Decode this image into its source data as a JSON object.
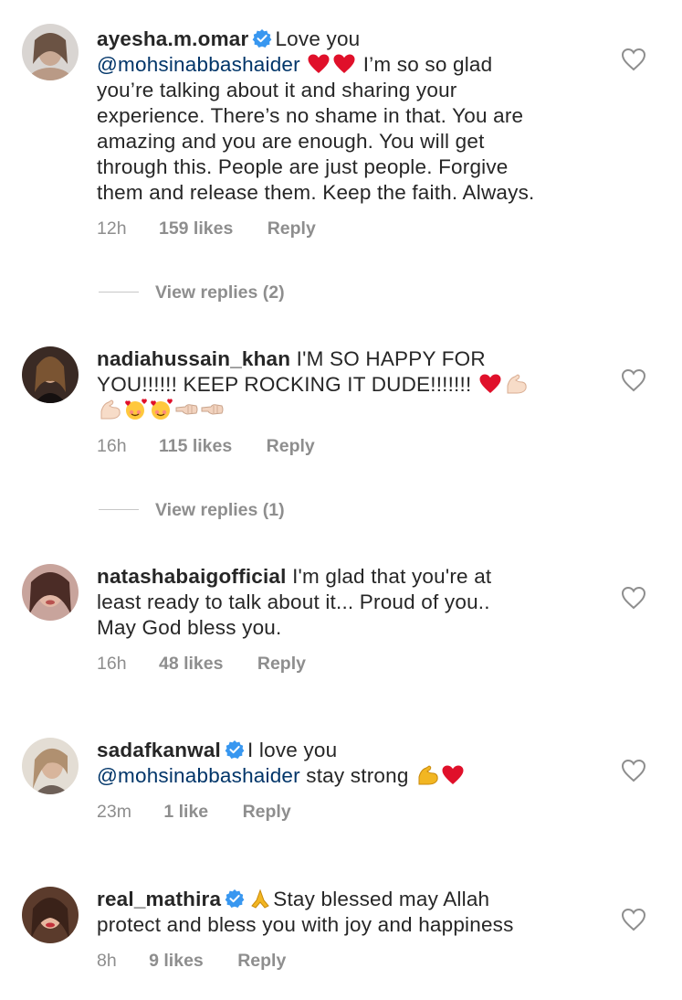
{
  "comments": [
    {
      "username": "ayesha.m.omar",
      "verified": true,
      "lines": [
        {
          "parts": [
            {
              "t": "Love you"
            }
          ]
        },
        {
          "parts": [
            {
              "m": "@mohsinabbashaider"
            },
            {
              "e": "heart"
            },
            {
              "e": "heart"
            },
            {
              "t": " I’m so so glad"
            }
          ]
        },
        {
          "parts": [
            {
              "t": "you’re talking about it and sharing your"
            }
          ]
        },
        {
          "parts": [
            {
              "t": "experience. There’s no shame in that. You are"
            }
          ]
        },
        {
          "parts": [
            {
              "t": "amazing and you are enough. You will get"
            }
          ]
        },
        {
          "parts": [
            {
              "t": "through this. People are just people. Forgive"
            }
          ]
        },
        {
          "parts": [
            {
              "t": "them and release them. Keep the faith. Always."
            }
          ]
        }
      ],
      "time": "12h",
      "likes": "159 likes",
      "reply": "Reply",
      "view_replies": "View replies (2)"
    },
    {
      "username": "nadiahussain_khan",
      "verified": false,
      "lines": [
        {
          "parts": [
            {
              "t": "I'M SO HAPPY FOR"
            }
          ]
        },
        {
          "parts": [
            {
              "t": "YOU!!!!!! KEEP ROCKING IT DUDE!!!!!!! "
            },
            {
              "e": "heart"
            },
            {
              "e": "muscle-light"
            }
          ]
        },
        {
          "parts": [
            {
              "e": "muscle-light"
            },
            {
              "e": "smiling-hearts"
            },
            {
              "e": "smiling-hearts"
            },
            {
              "e": "fist-left"
            },
            {
              "e": "fist-left"
            }
          ]
        }
      ],
      "time": "16h",
      "likes": "115 likes",
      "reply": "Reply",
      "view_replies": "View replies (1)"
    },
    {
      "username": "natashabaigofficial",
      "verified": false,
      "lines": [
        {
          "parts": [
            {
              "t": "I'm glad that you're at"
            }
          ]
        },
        {
          "parts": [
            {
              "t": "least ready to talk about it... Proud of you.."
            }
          ]
        },
        {
          "parts": [
            {
              "t": "May God bless you."
            }
          ]
        }
      ],
      "time": "16h",
      "likes": "48 likes",
      "reply": "Reply",
      "view_replies": ""
    },
    {
      "username": "sadafkanwal",
      "verified": true,
      "lines": [
        {
          "parts": [
            {
              "t": "I love you"
            }
          ]
        },
        {
          "parts": [
            {
              "m": "@mohsinabbashaider"
            },
            {
              "t": " stay strong "
            },
            {
              "e": "muscle"
            },
            {
              "e": "heart"
            }
          ]
        }
      ],
      "time": "23m",
      "likes": "1 like",
      "reply": "Reply",
      "view_replies": ""
    },
    {
      "username": "real_mathira",
      "verified": true,
      "lines": [
        {
          "parts": [
            {
              "e": "pray"
            },
            {
              "t": "Stay blessed may Allah"
            }
          ]
        },
        {
          "parts": [
            {
              "t": "protect and bless you with joy and happiness"
            }
          ]
        }
      ],
      "time": "8h",
      "likes": "9 likes",
      "reply": "Reply",
      "view_replies": ""
    }
  ],
  "colors": {
    "text": "#262626",
    "meta": "#8e8e8e",
    "mention": "#003569",
    "verified": "#3897f0",
    "heart_emoji": "#e0102a"
  },
  "icons": {
    "like": "heart-outline-icon",
    "verified": "verified-badge-icon"
  }
}
